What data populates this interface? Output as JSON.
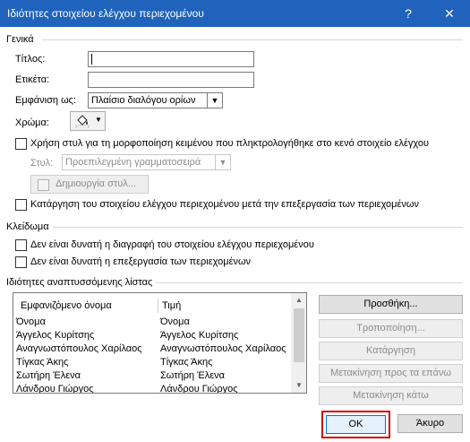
{
  "window": {
    "title": "Ιδιότητες στοιχείου ελέγχου περιεχομένου",
    "help_glyph": "?",
    "close_glyph": "✕"
  },
  "general": {
    "section_label": "Γενικά",
    "title_label": "Τίτλος:",
    "title_value": "",
    "tag_label": "Ετικέτα:",
    "tag_value": "",
    "show_as_label": "Εμφάνιση ως:",
    "show_as_value": "Πλαίσιο διαλόγου ορίων",
    "color_label": "Χρώμα:",
    "use_style_label": "Χρήση στυλ για τη μορφοποίηση κειμένου που πληκτρολογήθηκε στο κενό στοιχείο ελέγχου",
    "use_style_checked": false,
    "style_label": "Στυλ:",
    "style_value": "Προεπιλεγμένη γραμματοσειρά",
    "new_style_button": "Δημιουργία στυλ...",
    "remove_after_edit_label": "Κατάργηση του στοιχείου ελέγχου περιεχομένου μετά την επεξεργασία των περιεχομένων",
    "remove_after_edit_checked": false
  },
  "locking": {
    "section_label": "Κλείδωμα",
    "cannot_delete_label": "Δεν είναι δυνατή η διαγραφή του στοιχείου ελέγχου περιεχομένου",
    "cannot_delete_checked": false,
    "cannot_edit_label": "Δεν είναι δυνατή η επεξεργασία των περιεχομένων",
    "cannot_edit_checked": false
  },
  "list_props": {
    "section_label": "Ιδιότητες αναπτυσσόμενης λίστας",
    "col_display": "Εμφανιζόμενο όνομα",
    "col_value": "Τιμή",
    "rows": [
      {
        "display": "Όνομα",
        "value": "Όνομα"
      },
      {
        "display": "Άγγελος Κυρίτσης",
        "value": "Άγγελος Κυρίτσης"
      },
      {
        "display": "Αναγνωστόπουλος Χαρίλαος",
        "value": "Αναγνωστόπουλος Χαρίλαος"
      },
      {
        "display": "Τίγκας Άκης",
        "value": "Τίγκας Άκης"
      },
      {
        "display": "Σωτήρη Έλενα",
        "value": "Σωτήρη Έλενα"
      },
      {
        "display": "Λάνδρου Γιώργος",
        "value": "Λάνδρου Γιώργος"
      }
    ],
    "buttons": {
      "add": "Προσθήκη...",
      "modify": "Τροποποίηση...",
      "remove": "Κατάργηση",
      "move_up": "Μετακίνηση προς τα επάνω",
      "move_down": "Μετακίνηση κάτω"
    }
  },
  "footer": {
    "ok": "OK",
    "cancel": "Άκυρο"
  },
  "colors": {
    "titlebar": "#1f63bc",
    "highlight_border": "#d10000"
  }
}
